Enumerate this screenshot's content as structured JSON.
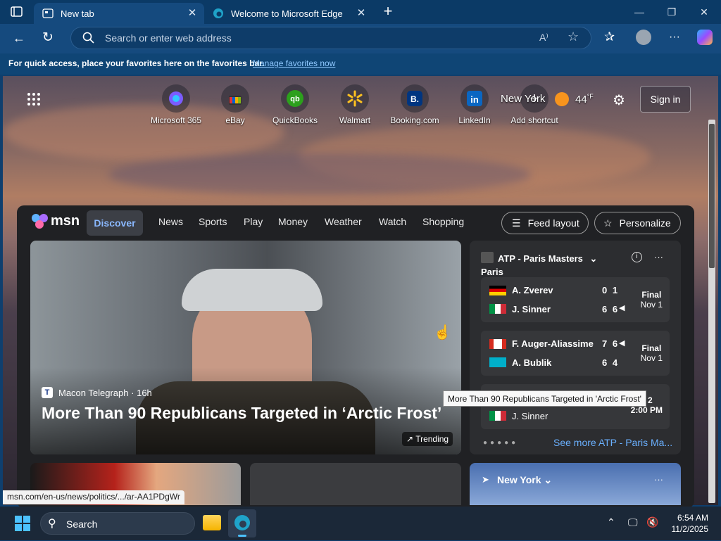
{
  "browser": {
    "tabs": [
      {
        "label": "New tab",
        "active": true
      },
      {
        "label": "Welcome to Microsoft Edge",
        "active": false
      }
    ],
    "address_placeholder": "Search or enter web address",
    "favorites_hint": "For quick access, place your favorites here on the favorites bar.",
    "favorites_link": "Manage favorites now"
  },
  "shortcuts": [
    {
      "label": "Microsoft 365",
      "icon": "m365-icon"
    },
    {
      "label": "eBay",
      "icon": "ebay-icon"
    },
    {
      "label": "QuickBooks",
      "icon": "quickbooks-icon"
    },
    {
      "label": "Walmart",
      "icon": "walmart-icon"
    },
    {
      "label": "Booking.com",
      "icon": "booking-icon"
    },
    {
      "label": "LinkedIn",
      "icon": "linkedin-icon"
    },
    {
      "label": "Add shortcut",
      "icon": "add-icon"
    }
  ],
  "header": {
    "city": "New York",
    "temp": "44",
    "temp_unit": "°F",
    "signin": "Sign in"
  },
  "msn": {
    "logo": "msn",
    "nav": [
      "Discover",
      "News",
      "Sports",
      "Play",
      "Money",
      "Weather",
      "Watch",
      "Shopping"
    ],
    "feed_layout": "Feed layout",
    "personalize": "Personalize"
  },
  "hero": {
    "source": "Macon Telegraph",
    "age": "16h",
    "source_sep": "·",
    "headline": "More Than 90 Republicans Targeted in ‘Arctic Frost’",
    "trending": "Trending"
  },
  "atp": {
    "title_line1": "ATP - Paris Masters",
    "title_line2": "Paris",
    "icon_alt": "ATP",
    "matches": [
      {
        "p1": "A. Zverev",
        "s1": "0 1",
        "p2": "J. Sinner",
        "s2": "6 6",
        "status": "Final",
        "date": "Nov 1"
      },
      {
        "p1": "F. Auger-Aliassime",
        "s1": "7 6",
        "p2": "A. Bublik",
        "s2": "6 4",
        "status": "Final",
        "date": "Nov 1"
      },
      {
        "p2": "J. Sinner",
        "date_partial": "v 2",
        "time": "2:00 PM"
      }
    ],
    "see_more": "See more ATP - Paris Ma..."
  },
  "tooltip": "More Than 90 Republicans Targeted in 'Arctic Frost'",
  "weather_card": {
    "city": "New York"
  },
  "status_url": "msn.com/en-us/news/politics/.../ar-AA1PDgWr",
  "taskbar": {
    "search": "Search",
    "time": "6:54 AM",
    "date": "11/2/2025"
  }
}
